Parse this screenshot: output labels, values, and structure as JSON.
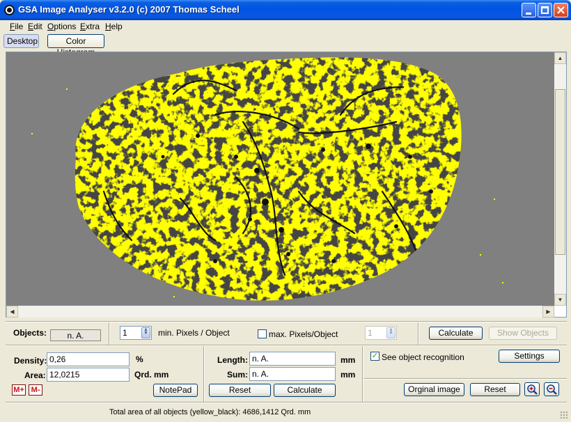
{
  "window": {
    "title": "GSA Image Analyser v3.2.0 (c) 2007  Thomas Scheel",
    "icon": "gsa-app-icon"
  },
  "menu": [
    {
      "label": "File",
      "key": "F",
      "rest": "ile"
    },
    {
      "label": "Edit",
      "key": "E",
      "rest": "dit"
    },
    {
      "label": "Options",
      "key": "O",
      "rest": "ptions"
    },
    {
      "label": "Extra",
      "key": "E",
      "rest": "xtra"
    },
    {
      "label": "Help",
      "key": "H",
      "rest": "elp"
    }
  ],
  "toolbar": {
    "desktop": "Desktop",
    "color_histogram": "Color Histogram"
  },
  "objects_panel": {
    "objects_label": "Objects:",
    "objects_value": "n. A.",
    "min_pixels_value": "1",
    "min_pixels_label": "min. Pixels / Object",
    "max_pixels_label": "max. Pixels/Object",
    "max_pixels_checked": false,
    "max_pixels_value": "1",
    "calculate": "Calculate",
    "show_objects": "Show Objects"
  },
  "density_panel": {
    "density_label": "Density:",
    "density_value": "0,26",
    "density_unit": "%",
    "area_label": "Area:",
    "area_value": "12,0215",
    "area_unit": "Qrd. mm",
    "notepad": "NotePad",
    "mplus": "M+",
    "mminus": "M-"
  },
  "length_panel": {
    "length_label": "Length:",
    "length_value": "n. A.",
    "length_unit": "mm",
    "sum_label": "Sum:",
    "sum_value": "n. A.",
    "sum_unit": "mm",
    "reset": "Reset",
    "calculate": "Calculate"
  },
  "recognition_panel": {
    "see_object_recognition": "See object recognition",
    "see_object_recognition_checked": true,
    "settings": "Settings",
    "original_image": "Orginal image",
    "reset": "Reset",
    "zoom_in": "zoom-in-icon",
    "zoom_out": "zoom-out-icon"
  },
  "status": {
    "text": "Total area of all objects (yellow_black): 4686,1412 Qrd. mm"
  },
  "colors": {
    "titlebar": "#0054e3",
    "canvas_bg": "#808080",
    "object_yellow": "#ffff00",
    "object_dark": "#101010"
  }
}
